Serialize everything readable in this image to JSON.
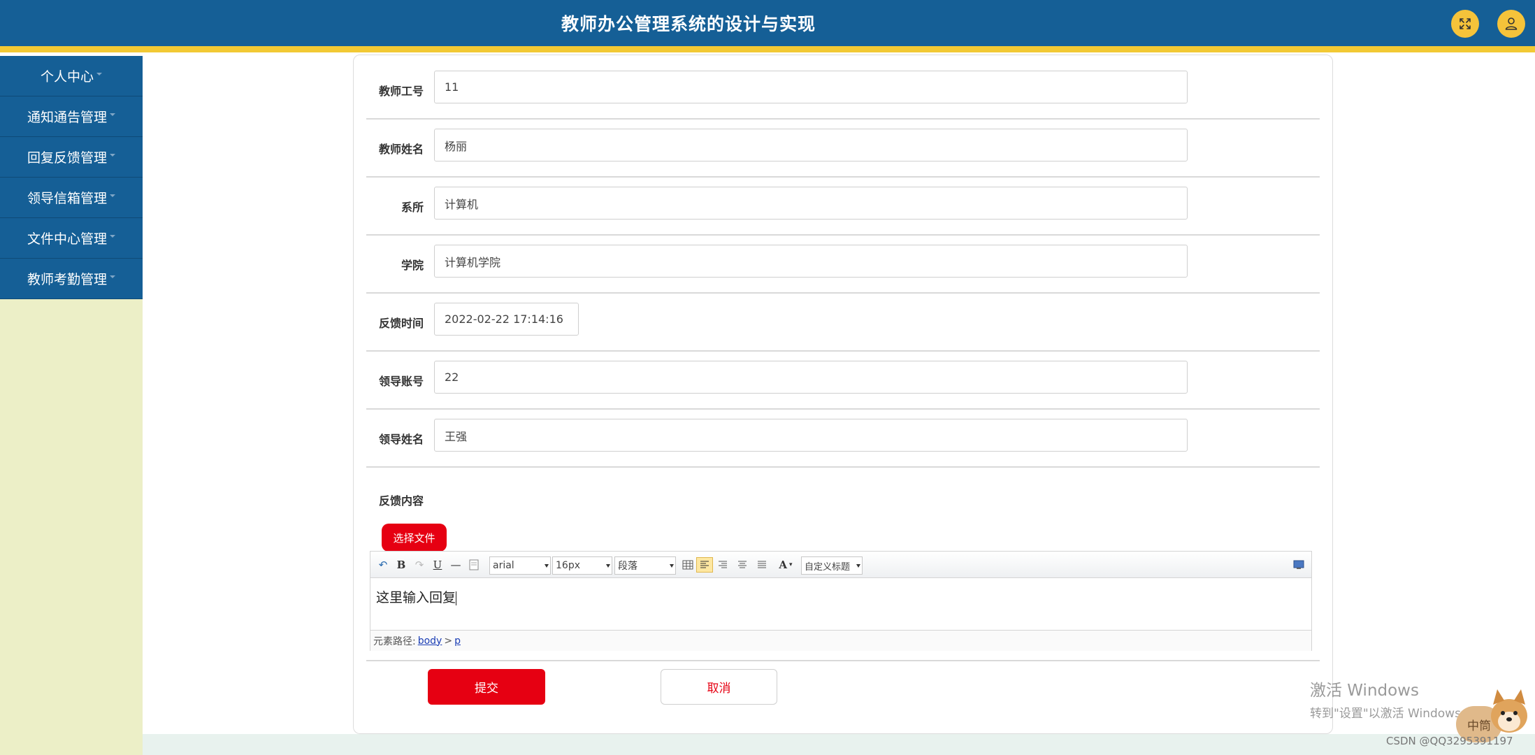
{
  "header": {
    "title": "教师办公管理系统的设计与实现",
    "fullscreen_icon": "expand-icon",
    "user_icon": "user-icon"
  },
  "sidebar": {
    "items": [
      {
        "label": "个人中心"
      },
      {
        "label": "通知通告管理"
      },
      {
        "label": "回复反馈管理"
      },
      {
        "label": "领导信箱管理"
      },
      {
        "label": "文件中心管理"
      },
      {
        "label": "教师考勤管理"
      }
    ]
  },
  "form": {
    "teacher_id": {
      "label": "教师工号",
      "value": "11"
    },
    "teacher_name": {
      "label": "教师姓名",
      "value": "杨丽"
    },
    "department": {
      "label": "系所",
      "value": "计算机"
    },
    "college": {
      "label": "学院",
      "value": "计算机学院"
    },
    "feedback_time": {
      "label": "反馈时间",
      "value": "2022-02-22 17:14:16"
    },
    "leader_account": {
      "label": "领导账号",
      "value": "22"
    },
    "leader_name": {
      "label": "领导姓名",
      "value": "王强"
    },
    "content_label": "反馈内容",
    "choose_file": "选择文件"
  },
  "editor": {
    "font_family": "arial",
    "font_size": "16px",
    "paragraph": "段落",
    "custom_heading": "自定义标题",
    "content": "这里输入回复",
    "path_label": "元素路径:",
    "path_body": "body",
    "path_sep": ">",
    "path_p": "p"
  },
  "actions": {
    "submit": "提交",
    "cancel": "取消"
  },
  "watermark": {
    "line1": "激活 Windows",
    "line2": "转到\"设置\"以激活 Windows。"
  },
  "footer": {
    "csdn": "CSDN @QQ3295391197",
    "ime": "中筒"
  },
  "colors": {
    "header": "#155f96",
    "accent_stripe": "#f2c934",
    "primary_red": "#e60012",
    "sidebar_bg": "#ecefc7"
  }
}
